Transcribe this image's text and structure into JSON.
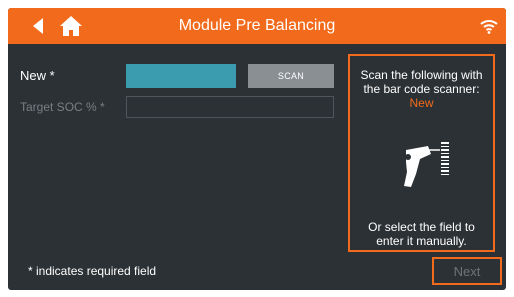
{
  "header": {
    "title": "Module Pre Balancing",
    "back_icon": "back-arrow-icon",
    "home_icon": "home-icon",
    "status_icon": "wifi-icon",
    "accent_color": "#f26a1b"
  },
  "form": {
    "new_label": "New *",
    "scan_label": "SCAN",
    "target_soc_label": "Target SOC % *",
    "new_field_color": "#3b9cb0"
  },
  "panel": {
    "line1": "Scan the following with",
    "line2": "the bar code scanner:",
    "target": "New",
    "scanner_icon": "barcode-scanner-icon",
    "footer_line1": "Or select the field to",
    "footer_line2": "enter it manually."
  },
  "footer": {
    "required_note": "* indicates required field",
    "next_label": "Next"
  }
}
